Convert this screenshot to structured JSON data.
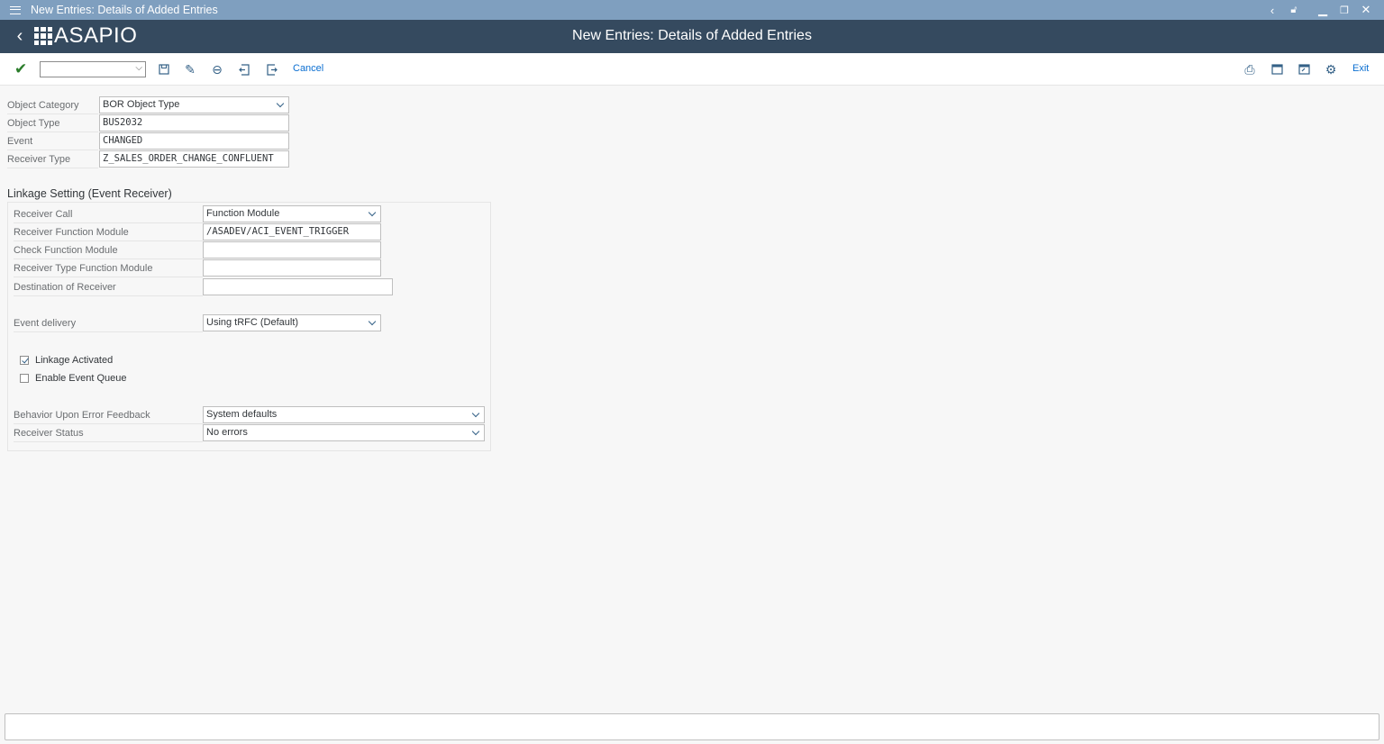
{
  "window": {
    "title": "New Entries: Details of Added Entries"
  },
  "header": {
    "logo_text": "ASAPIO",
    "page_title": "New Entries: Details of Added Entries"
  },
  "toolbar": {
    "command_field_value": "",
    "cancel_label": "Cancel",
    "exit_label": "Exit"
  },
  "object": {
    "category_label": "Object Category",
    "category_value": "BOR Object Type",
    "type_label": "Object Type",
    "type_value": "BUS2032",
    "event_label": "Event",
    "event_value": "CHANGED",
    "receiver_type_label": "Receiver Type",
    "receiver_type_value": "Z_SALES_ORDER_CHANGE_CONFLUENT"
  },
  "linkage": {
    "section_title": "Linkage Setting (Event Receiver)",
    "receiver_call_label": "Receiver Call",
    "receiver_call_value": "Function Module",
    "receiver_fm_label": "Receiver Function Module",
    "receiver_fm_value": "/ASADEV/ACI_EVENT_TRIGGER",
    "check_fm_label": "Check Function Module",
    "check_fm_value": "",
    "receiver_type_fm_label": "Receiver Type Function Module",
    "receiver_type_fm_value": "",
    "destination_label": "Destination of Receiver",
    "destination_value": "",
    "event_delivery_label": "Event delivery",
    "event_delivery_value": "Using tRFC (Default)",
    "linkage_activated_label": "Linkage Activated",
    "linkage_activated_checked": true,
    "enable_queue_label": "Enable Event Queue",
    "enable_queue_checked": false,
    "error_feedback_label": "Behavior Upon Error Feedback",
    "error_feedback_value": "System defaults",
    "receiver_status_label": "Receiver Status",
    "receiver_status_value": "No errors"
  },
  "colors": {
    "title_bar": "#7f9fbf",
    "header_bar": "#354a5f",
    "accent": "#0a6ed1",
    "check_green": "#2b7d2b"
  }
}
